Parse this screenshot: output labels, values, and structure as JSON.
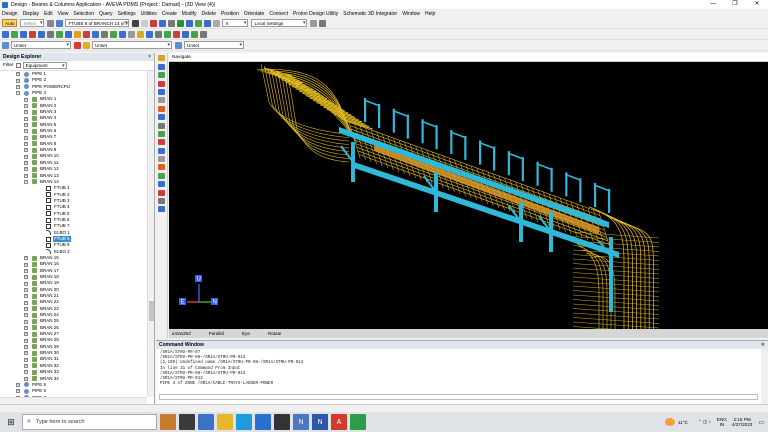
{
  "window": {
    "title": "Design - Beams & Columns Application - AVEVA PDMS (Project : Damad) - (3D View (4))"
  },
  "menu": [
    "Design",
    "Display",
    "Edit",
    "View",
    "Selection",
    "Query",
    "Settings",
    "Utilities",
    "Create",
    "Modify",
    "Delete",
    "Position",
    "Orientate",
    "Connect",
    "Proton Design Utility",
    "Schematic 3D Integrator",
    "Window",
    "Help"
  ],
  "toolbar": {
    "auto_label": "Auto",
    "select_placeholder": "Select",
    "element_combo": "FTUBE 8 of BRANCH 14 of PII",
    "mode_combo": "X",
    "settings_combo": "Local Settings"
  },
  "toolbar3": {
    "field1": "Unset",
    "field2": "Unset",
    "field3": "Unset"
  },
  "explorer": {
    "title": "Design Explorer",
    "close": "×",
    "filter_label": "Filter",
    "filter_value": "Equipment",
    "rows": [
      {
        "label": "PIPE 1",
        "icon": "pipe",
        "indent": 24,
        "exp": "+"
      },
      {
        "label": "PIPE 2",
        "icon": "pipe",
        "indent": 24,
        "exp": "+"
      },
      {
        "label": "PIPE POWERCPU",
        "icon": "pipe",
        "indent": 24,
        "exp": "+"
      },
      {
        "label": "PIPE 4",
        "icon": "pipe",
        "indent": 24,
        "exp": "-"
      },
      {
        "label": "BRAN 1",
        "icon": "bran",
        "indent": 32,
        "exp": "+"
      },
      {
        "label": "BRAN 2",
        "icon": "bran",
        "indent": 32,
        "exp": "+"
      },
      {
        "label": "BRAN 3",
        "icon": "bran",
        "indent": 32,
        "exp": "+"
      },
      {
        "label": "BRAN 4",
        "icon": "bran",
        "indent": 32,
        "exp": "+"
      },
      {
        "label": "BRAN 5",
        "icon": "bran",
        "indent": 32,
        "exp": "+"
      },
      {
        "label": "BRAN 6",
        "icon": "bran",
        "indent": 32,
        "exp": "+"
      },
      {
        "label": "BRAN 7",
        "icon": "bran",
        "indent": 32,
        "exp": "+"
      },
      {
        "label": "BRAN 8",
        "icon": "bran",
        "indent": 32,
        "exp": "+"
      },
      {
        "label": "BRAN 9",
        "icon": "bran",
        "indent": 32,
        "exp": "+"
      },
      {
        "label": "BRAN 10",
        "icon": "bran",
        "indent": 32,
        "exp": "+"
      },
      {
        "label": "BRAN 11",
        "icon": "bran",
        "indent": 32,
        "exp": "+"
      },
      {
        "label": "BRAN 12",
        "icon": "bran",
        "indent": 32,
        "exp": "+"
      },
      {
        "label": "BRAN 13",
        "icon": "bran",
        "indent": 32,
        "exp": "+"
      },
      {
        "label": "BRAN 14",
        "icon": "bran",
        "indent": 32,
        "exp": "-"
      },
      {
        "label": "FTUB 1",
        "icon": "ftub",
        "indent": 46,
        "exp": ""
      },
      {
        "label": "FTUB 2",
        "icon": "ftub",
        "indent": 46,
        "exp": ""
      },
      {
        "label": "FTUB 3",
        "icon": "ftub",
        "indent": 46,
        "exp": ""
      },
      {
        "label": "FTUB 4",
        "icon": "ftub",
        "indent": 46,
        "exp": ""
      },
      {
        "label": "FTUB 5",
        "icon": "ftub",
        "indent": 46,
        "exp": ""
      },
      {
        "label": "FTUB 6",
        "icon": "ftub",
        "indent": 46,
        "exp": ""
      },
      {
        "label": "FTUB 7",
        "icon": "ftub",
        "indent": 46,
        "exp": ""
      },
      {
        "label": "ELBO 1",
        "icon": "elbo",
        "indent": 46,
        "exp": ""
      },
      {
        "label": "FTUB 8",
        "icon": "ftub",
        "indent": 46,
        "exp": "",
        "selected": true
      },
      {
        "label": "FTUB 9",
        "icon": "ftub",
        "indent": 46,
        "exp": ""
      },
      {
        "label": "ELBO 2",
        "icon": "elbo",
        "indent": 46,
        "exp": ""
      },
      {
        "label": "BRAN 15",
        "icon": "bran",
        "indent": 32,
        "exp": "+"
      },
      {
        "label": "BRAN 16",
        "icon": "bran",
        "indent": 32,
        "exp": "+"
      },
      {
        "label": "BRAN 17",
        "icon": "bran",
        "indent": 32,
        "exp": "+"
      },
      {
        "label": "BRAN 18",
        "icon": "bran",
        "indent": 32,
        "exp": "+"
      },
      {
        "label": "BRAN 19",
        "icon": "bran",
        "indent": 32,
        "exp": "+"
      },
      {
        "label": "BRAN 20",
        "icon": "bran",
        "indent": 32,
        "exp": "+"
      },
      {
        "label": "BRAN 21",
        "icon": "bran",
        "indent": 32,
        "exp": "+"
      },
      {
        "label": "BRAN 22",
        "icon": "bran",
        "indent": 32,
        "exp": "+"
      },
      {
        "label": "BRAN 23",
        "icon": "bran",
        "indent": 32,
        "exp": "+"
      },
      {
        "label": "BRAN 24",
        "icon": "bran",
        "indent": 32,
        "exp": "+"
      },
      {
        "label": "BRAN 25",
        "icon": "bran",
        "indent": 32,
        "exp": "+"
      },
      {
        "label": "BRAN 26",
        "icon": "bran",
        "indent": 32,
        "exp": "+"
      },
      {
        "label": "BRAN 27",
        "icon": "bran",
        "indent": 32,
        "exp": "+"
      },
      {
        "label": "BRAN 28",
        "icon": "bran",
        "indent": 32,
        "exp": "+"
      },
      {
        "label": "BRAN 29",
        "icon": "bran",
        "indent": 32,
        "exp": "+"
      },
      {
        "label": "BRAN 30",
        "icon": "bran",
        "indent": 32,
        "exp": "+"
      },
      {
        "label": "BRAN 31",
        "icon": "bran",
        "indent": 32,
        "exp": "+"
      },
      {
        "label": "BRAN 32",
        "icon": "bran",
        "indent": 32,
        "exp": "+"
      },
      {
        "label": "BRAN 33",
        "icon": "bran",
        "indent": 32,
        "exp": "+"
      },
      {
        "label": "BRAN 34",
        "icon": "bran",
        "indent": 32,
        "exp": "+"
      },
      {
        "label": "PIPE 5",
        "icon": "pipe",
        "indent": 24,
        "exp": "+"
      },
      {
        "label": "PIPE 6",
        "icon": "pipe",
        "indent": 24,
        "exp": "+"
      },
      {
        "label": "PIPE 7",
        "icon": "pipe",
        "indent": 24,
        "exp": "+"
      }
    ]
  },
  "view": {
    "title": "Navigate",
    "axes": {
      "up": "U",
      "east": "E",
      "north": "N"
    },
    "status": [
      "e42w25d",
      "Parallel",
      "Eye",
      "Rotate"
    ],
    "colors": {
      "tray": "#e8c020",
      "steel": "#2fb8d8",
      "pipe": "#d89a2a"
    }
  },
  "command": {
    "title": "Command Window",
    "lines": [
      "/SR1A/STRU-PR-07",
      "/SR1A/STRU-PR-08-/SR1A/STRU-PR-013",
      "(2,109)   Undefined name /SR1A/STRU-PR-08-/SR1A/STRU-PR-013",
      "In line 31 of Command Prom Input",
      "/SR1A/STRU-PR-08-/SR1A/STRU-PR-013",
      "/SR1A/STRU-PR-013",
      "PIPE 4 of ZONE /SR1A/CABLE-TRAYS-LADDER-POWER"
    ]
  },
  "taskbar": {
    "search_placeholder": "Type here to search",
    "weather": "11°C",
    "lang": "ENG",
    "region": "IN",
    "time": "2:15 PM",
    "date": "4/27/2023"
  }
}
